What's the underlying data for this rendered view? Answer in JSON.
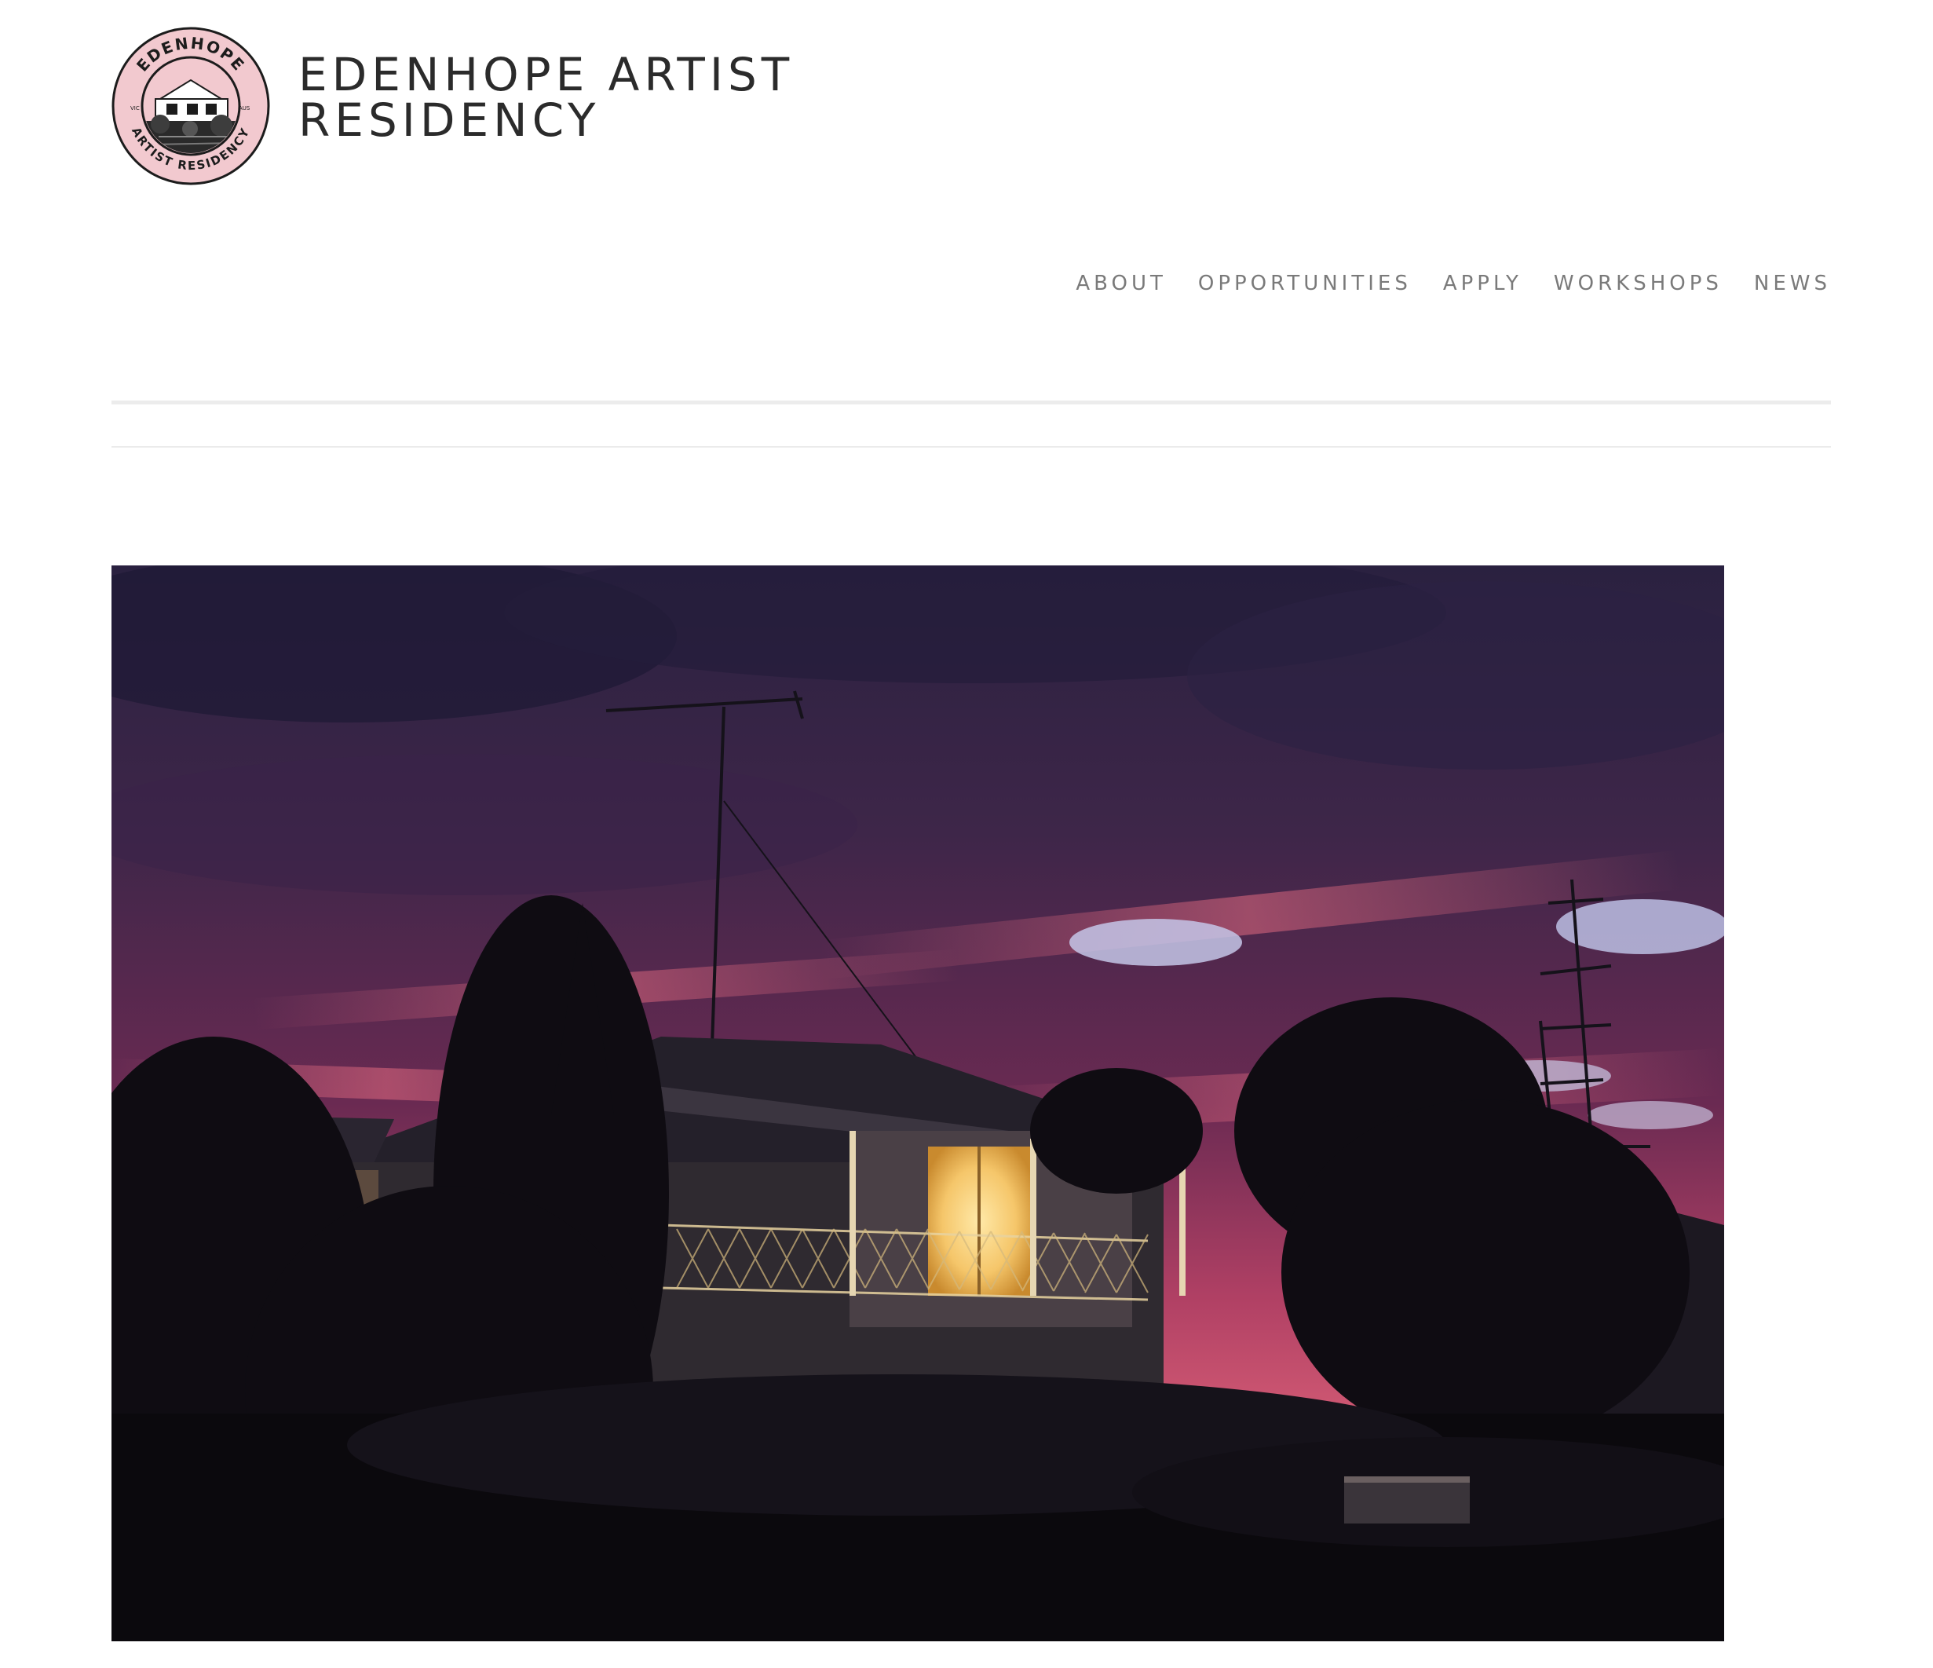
{
  "site": {
    "title_line1": "EDENHOPE ARTIST",
    "title_line2": "RESIDENCY",
    "logo": {
      "icon": "edenhope-badge-logo",
      "ring_text_top": "EDENHOPE",
      "ring_text_bottom": "ARTIST RESIDENCY",
      "left_mark": "VIC",
      "right_mark": "AUS",
      "fill_color": "#f2c9cf",
      "ring_color": "#1c1c1c"
    }
  },
  "nav": {
    "items": [
      {
        "label": "ABOUT"
      },
      {
        "label": "OPPORTUNITIES"
      },
      {
        "label": "APPLY"
      },
      {
        "label": "WORKSHOPS"
      },
      {
        "label": "NEWS"
      }
    ]
  },
  "hero": {
    "subject": "house-at-dusk-photo",
    "sky_colors": [
      "#2a2140",
      "#5a2a4e",
      "#c2456a",
      "#e2707f"
    ],
    "window_glow": "#f5c66a"
  },
  "colors": {
    "text": "#2b2b2b",
    "nav_text": "#7a7a7a",
    "divider": "#ececec",
    "background": "#ffffff"
  }
}
